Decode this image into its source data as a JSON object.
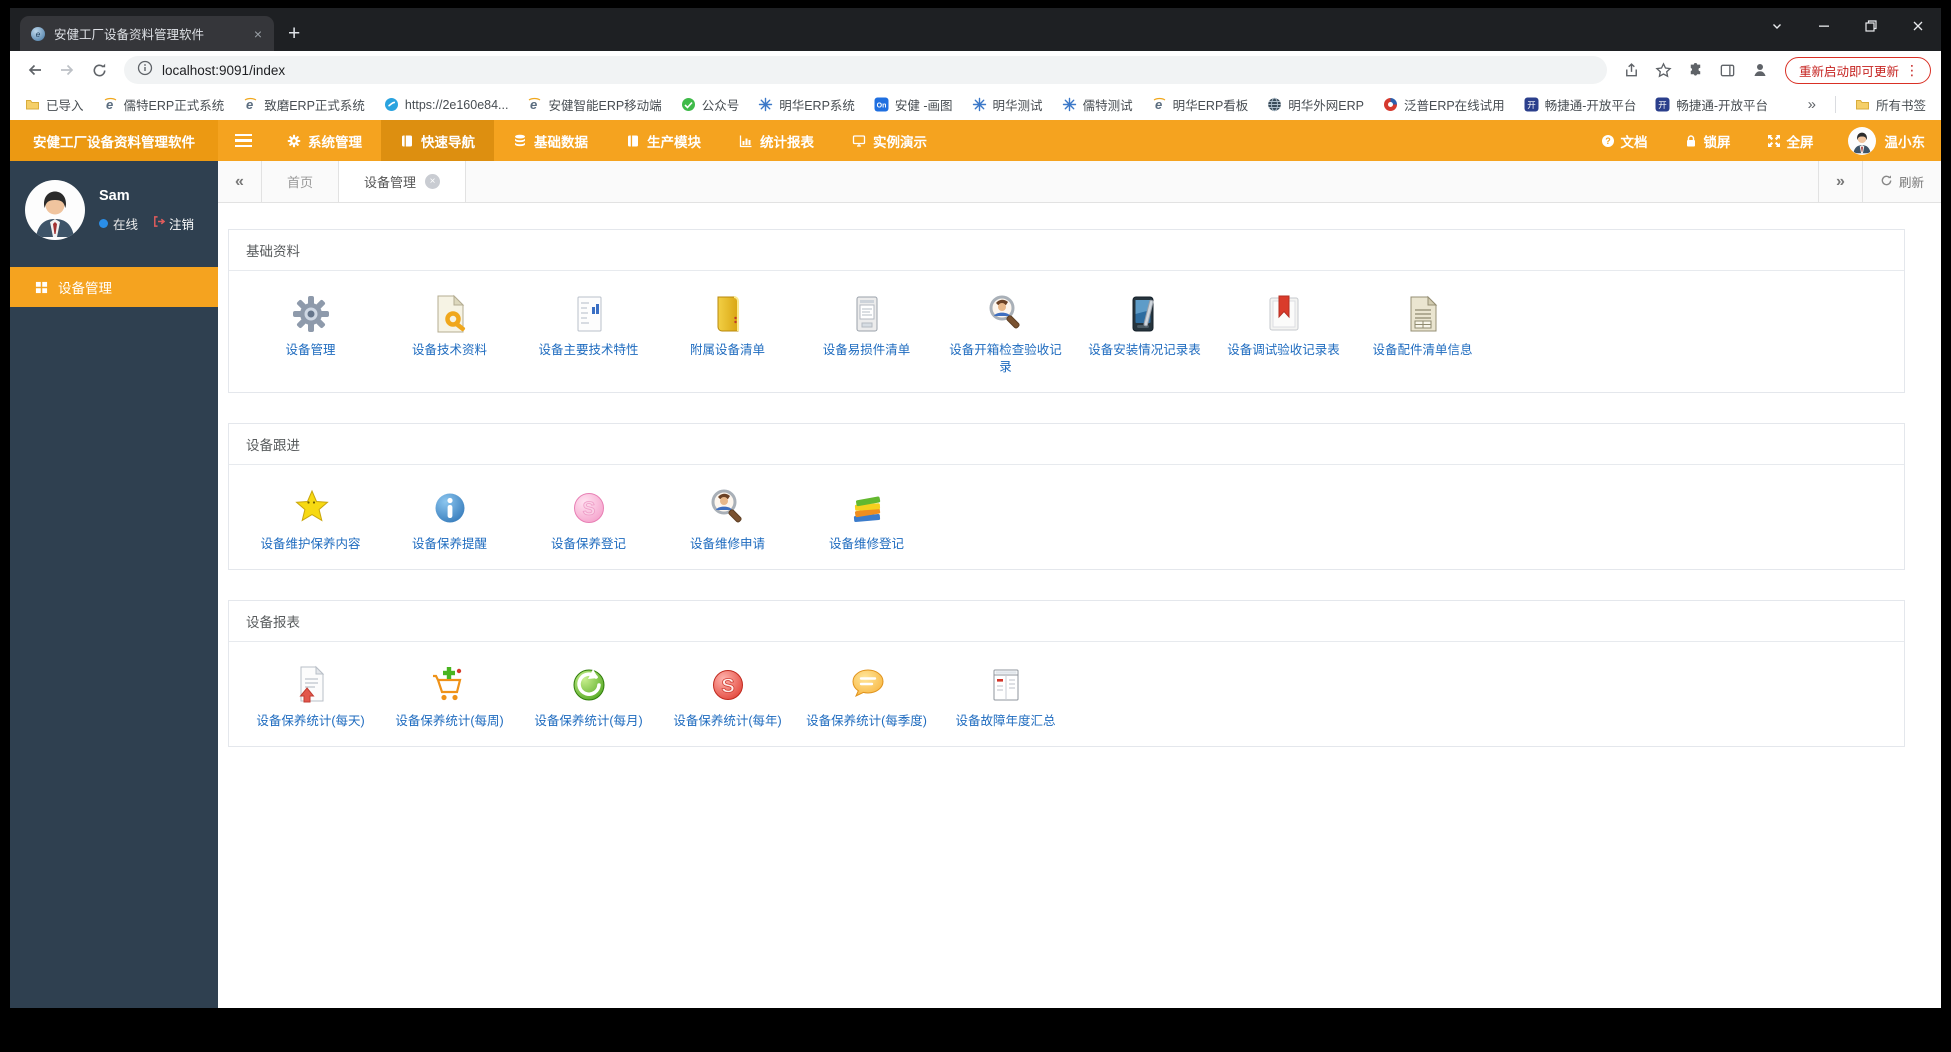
{
  "browser": {
    "tab_title": "安健工厂设备资料管理软件",
    "url": "localhost:9091/index",
    "update_chip": "重新启动即可更新",
    "bookmarks": [
      {
        "label": "已导入",
        "icon": "folder"
      },
      {
        "label": "儒特ERP正式系统",
        "icon": "e-logo"
      },
      {
        "label": "致磨ERP正式系统",
        "icon": "e-logo"
      },
      {
        "label": "https://2e160e84...",
        "icon": "swirl"
      },
      {
        "label": "安健智能ERP移动端",
        "icon": "e-logo"
      },
      {
        "label": "公众号",
        "icon": "wechat"
      },
      {
        "label": "明华ERP系统",
        "icon": "flower"
      },
      {
        "label": "安健 -画图",
        "icon": "on-badge"
      },
      {
        "label": "明华测试",
        "icon": "flower"
      },
      {
        "label": "儒特测试",
        "icon": "flower"
      },
      {
        "label": "明华ERP看板",
        "icon": "e-logo"
      },
      {
        "label": "明华外网ERP",
        "icon": "globe"
      },
      {
        "label": "泛普ERP在线试用",
        "icon": "fanpu"
      },
      {
        "label": "畅捷通-开放平台",
        "icon": "kai"
      },
      {
        "label": "畅捷通-开放平台",
        "icon": "kai"
      }
    ],
    "overflow_chevron": "»",
    "all_bookmarks": "所有书签"
  },
  "app": {
    "brand": "安健工厂设备资料管理软件",
    "nav": [
      {
        "label": "系统管理",
        "icon": "gear"
      },
      {
        "label": "快速导航",
        "icon": "book",
        "active": true
      },
      {
        "label": "基础数据",
        "icon": "database"
      },
      {
        "label": "生产模块",
        "icon": "module"
      },
      {
        "label": "统计报表",
        "icon": "chart"
      },
      {
        "label": "实例演示",
        "icon": "monitor"
      }
    ],
    "nav_right": [
      {
        "label": "文档",
        "icon": "help"
      },
      {
        "label": "锁屏",
        "icon": "lock"
      },
      {
        "label": "全屏",
        "icon": "fullscreen"
      }
    ],
    "user": {
      "display_name": "温小东"
    },
    "sidebar": {
      "username": "Sam",
      "status": "在线",
      "logout": "注销",
      "menu": [
        {
          "label": "设备管理",
          "icon": "grid",
          "active": true
        }
      ]
    },
    "page_tabs": {
      "home": "首页",
      "active": "设备管理",
      "refresh": "刷新"
    },
    "panels": [
      {
        "title": "基础资料",
        "items": [
          {
            "label": "设备管理",
            "icon": "gear-gray"
          },
          {
            "label": "设备技术资料",
            "icon": "doc-key"
          },
          {
            "label": "设备主要技术特性",
            "icon": "doc-chart"
          },
          {
            "label": "附属设备清单",
            "icon": "yellow-book"
          },
          {
            "label": "设备易损件清单",
            "icon": "device"
          },
          {
            "label": "设备开箱检查验收记录",
            "icon": "search-person"
          },
          {
            "label": "设备安装情况记录表",
            "icon": "pda"
          },
          {
            "label": "设备调试验收记录表",
            "icon": "bookmark-doc"
          },
          {
            "label": "设备配件清单信息",
            "icon": "doc-lines"
          }
        ]
      },
      {
        "title": "设备跟进",
        "items": [
          {
            "label": "设备维护保养内容",
            "icon": "star"
          },
          {
            "label": "设备保养提醒",
            "icon": "info"
          },
          {
            "label": "设备保养登记",
            "icon": "pink-sphere"
          },
          {
            "label": "设备维修申请",
            "icon": "search-person"
          },
          {
            "label": "设备维修登记",
            "icon": "books-stack"
          }
        ]
      },
      {
        "title": "设备报表",
        "items": [
          {
            "label": "设备保养统计(每天)",
            "icon": "doc-up"
          },
          {
            "label": "设备保养统计(每周)",
            "icon": "cart-plus"
          },
          {
            "label": "设备保养统计(每月)",
            "icon": "green-arrow"
          },
          {
            "label": "设备保养统计(每年)",
            "icon": "red-sphere"
          },
          {
            "label": "设备保养统计(每季度)",
            "icon": "speech"
          },
          {
            "label": "设备故障年度汇总",
            "icon": "window-doc"
          }
        ]
      }
    ]
  },
  "colors": {
    "accent_orange": "#f5a31f",
    "active_orange": "#dd8f10",
    "brand_orange": "#ec9912",
    "sidebar_navy": "#2f4050",
    "link_blue": "#1e6bbf",
    "update_red": "#c5221f",
    "status_blue": "#2a8ee8"
  }
}
